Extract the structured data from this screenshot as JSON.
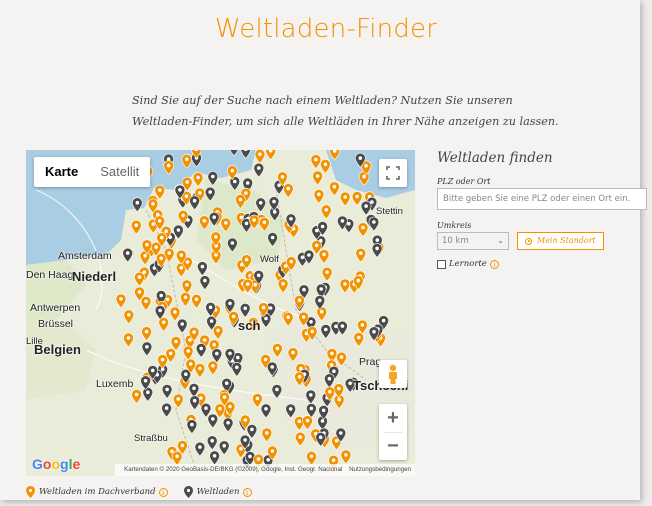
{
  "header": {
    "title": "Weltladen-Finder"
  },
  "intro": {
    "line1": "Sind Sie auf der Suche nach einem Weltladen? Nutzen Sie unseren",
    "line2": "Weltladen-Finder, um sich alle Weltläden in Ihrer Nähe anzeigen zu lassen."
  },
  "map": {
    "type_control": {
      "map_label": "Karte",
      "satellite_label": "Satellit"
    },
    "zoom_in": "+",
    "zoom_out": "−",
    "cities": {
      "stettin": "Stettin",
      "amsterdam": "Amsterdam",
      "den_haag": "Den Haag",
      "niederl": "Niederl",
      "antwerpen": "Antwerpen",
      "bruessel": "Brüssel",
      "lille": "Lille",
      "belgien": "Belgien",
      "luxemb": "Luxemb",
      "prag": "Prag",
      "tschechi": "Tschechi",
      "strassburg": "Straßbu",
      "berlin_part": "sch",
      "wolf": "Wolf"
    },
    "google_logo": "Google",
    "attribution": {
      "copyright": "Kartendaten © 2020 GeoBasis-DE/BKG (©2009), Google, Inst. Geogr. Nacional",
      "terms": "Nutzungsbedingungen"
    },
    "marker_colors": {
      "dachverband": "#f39200",
      "weltladen": "#4a4a4a"
    }
  },
  "legend": {
    "dachverband_label": "Weltladen im Dachverband",
    "weltladen_label": "Weltladen",
    "info_glyph": "i"
  },
  "finder": {
    "heading": "Weltladen finden",
    "plz_label": "PLZ oder Ort",
    "plz_placeholder": "Bitte geben Sie eine PLZ oder einen Ort ein.",
    "radius_label": "Umkreis",
    "radius_value": "10 km",
    "locate_button": "Mein Standort",
    "lernorte_label": "Lernorte",
    "info_glyph": "i"
  },
  "colors": {
    "accent": "#f39200",
    "background": "#f4f3f1"
  }
}
